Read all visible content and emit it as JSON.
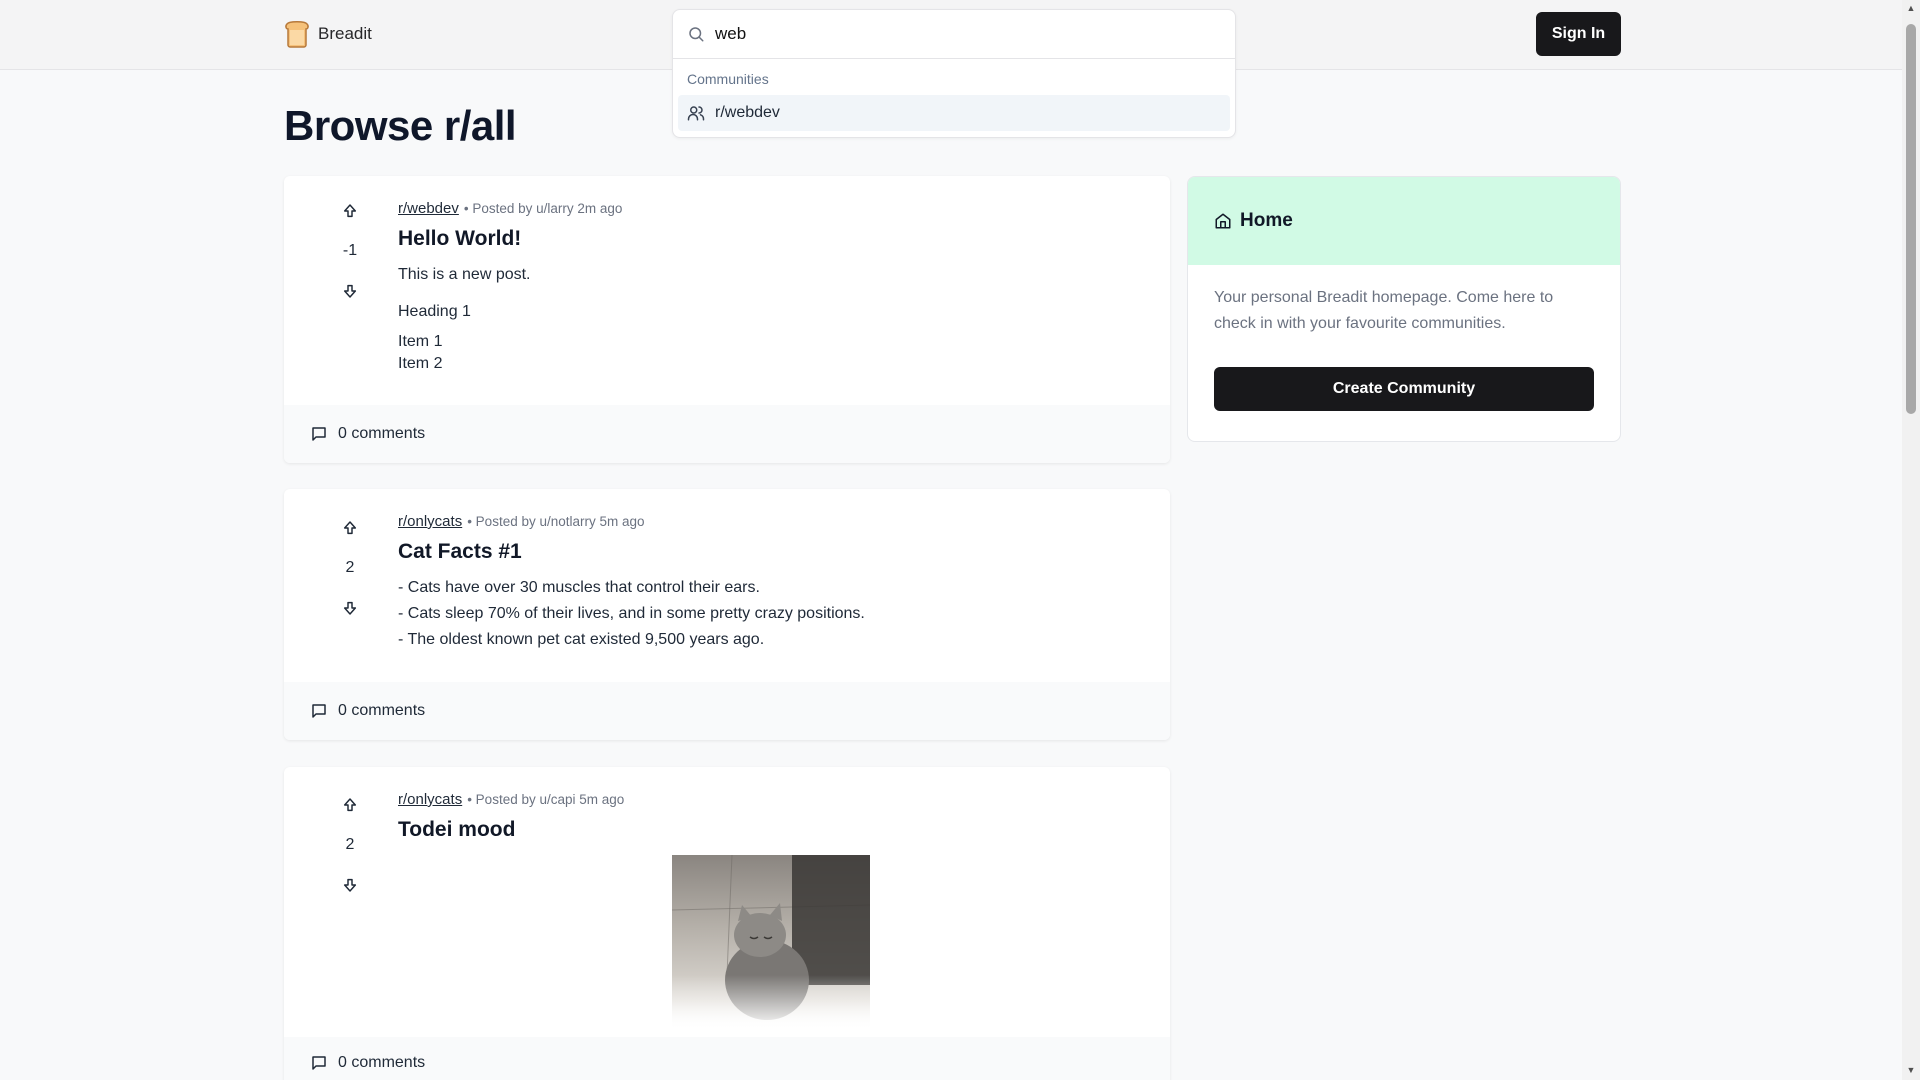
{
  "header": {
    "logo_text": "Breadit",
    "search": {
      "value": "web",
      "placeholder": ""
    },
    "dropdown": {
      "heading": "Communities",
      "items": [
        {
          "label": "r/webdev"
        }
      ]
    },
    "signin_label": "Sign In"
  },
  "page_title": "Browse r/all",
  "posts": [
    {
      "subreddit": "r/webdev",
      "meta": "• Posted by u/larry 2m ago",
      "title": "Hello World!",
      "votes": "-1",
      "lines": [
        "This is a new post.",
        "Heading 1",
        "Item 1",
        "Item 2"
      ],
      "comments": "0 comments"
    },
    {
      "subreddit": "r/onlycats",
      "meta": "• Posted by u/notlarry 5m ago",
      "title": "Cat Facts #1",
      "votes": "2",
      "lines": [
        "- Cats have over 30 muscles that control their ears.",
        "- Cats sleep 70% of their lives, and in some pretty crazy positions.",
        "- The oldest known pet cat existed 9,500 years ago."
      ],
      "comments": "0 comments"
    },
    {
      "subreddit": "r/onlycats",
      "meta": "• Posted by u/capi 5m ago",
      "title": "Todei mood",
      "votes": "2",
      "lines": [],
      "comments": "0 comments"
    }
  ],
  "sidebar": {
    "title": "Home",
    "description": "Your personal Breadit homepage. Come here to check in with your favourite communities.",
    "create_label": "Create Community"
  },
  "colors": {
    "accent_green": "#d1fae5",
    "button_dark": "#18181b",
    "page_bg": "#f8f9fa"
  }
}
